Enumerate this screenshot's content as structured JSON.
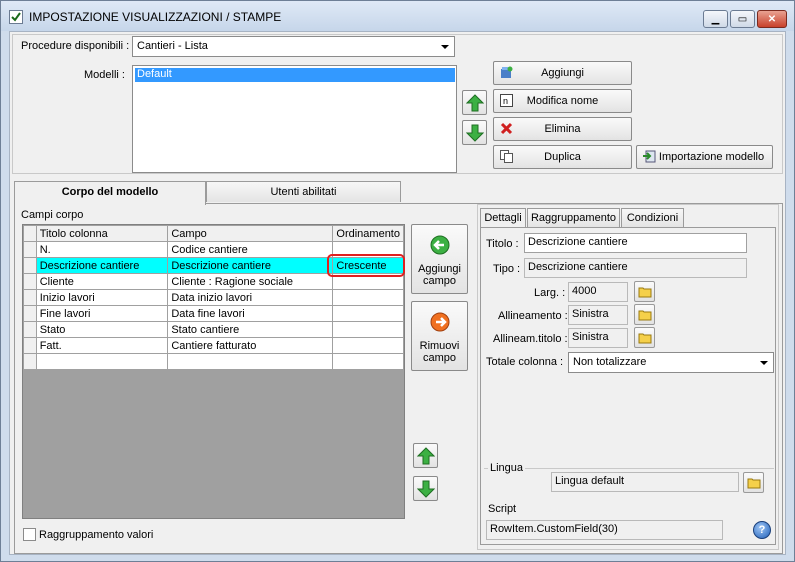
{
  "window": {
    "title": "IMPOSTAZIONE VISUALIZZAZIONI / STAMPE"
  },
  "top": {
    "procedure_label": "Procedure disponibili :",
    "procedure_value": "Cantieri - Lista",
    "modelli_label": "Modelli :",
    "modelli_items": [
      "Default"
    ],
    "buttons": {
      "add": "Aggiungi",
      "rename": "Modifica nome",
      "delete": "Elimina",
      "duplicate": "Duplica",
      "import": "Importazione modello"
    }
  },
  "tabs": {
    "corpo": "Corpo del modello",
    "utenti": "Utenti abilitati"
  },
  "campi": {
    "label": "Campi corpo",
    "headers": [
      "Titolo colonna",
      "Campo",
      "Ordinamento"
    ],
    "rows": [
      {
        "titolo": "N.",
        "campo": "Codice cantiere",
        "ordinamento": ""
      },
      {
        "titolo": "Descrizione cantiere",
        "campo": "Descrizione cantiere",
        "ordinamento": "Crescente"
      },
      {
        "titolo": "Cliente",
        "campo": "Cliente : Ragione sociale",
        "ordinamento": ""
      },
      {
        "titolo": "Inizio lavori",
        "campo": "Data inizio lavori",
        "ordinamento": ""
      },
      {
        "titolo": "Fine lavori",
        "campo": "Data fine lavori",
        "ordinamento": ""
      },
      {
        "titolo": "Stato",
        "campo": "Stato cantiere",
        "ordinamento": ""
      },
      {
        "titolo": "Fatt.",
        "campo": "Cantiere fatturato",
        "ordinamento": ""
      },
      {
        "titolo": "",
        "campo": "",
        "ordinamento": ""
      }
    ],
    "add_field": "Aggiungi campo",
    "remove_field": "Rimuovi campo",
    "group_values": "Raggruppamento valori"
  },
  "details": {
    "tabs": [
      "Dettagli",
      "Raggruppamento",
      "Condizioni"
    ],
    "titolo_label": "Titolo :",
    "titolo_value": "Descrizione cantiere",
    "tipo_label": "Tipo :",
    "tipo_value": "Descrizione cantiere",
    "larg_label": "Larg. :",
    "larg_value": "4000",
    "allineamento_label": "Allineamento :",
    "allineamento_value": "Sinistra",
    "allineam_titolo_label": "Allineam.titolo :",
    "allineam_titolo_value": "Sinistra",
    "totale_label": "Totale colonna :",
    "totale_value": "Non totalizzare",
    "lingua_label": "Lingua",
    "lingua_value": "Lingua default",
    "script_label": "Script",
    "script_value": "RowItem.CustomField(30)"
  },
  "colors": {
    "selection": "#00ffff",
    "highlight_ring": "#e02020",
    "listbox_selection": "#3399ff"
  }
}
